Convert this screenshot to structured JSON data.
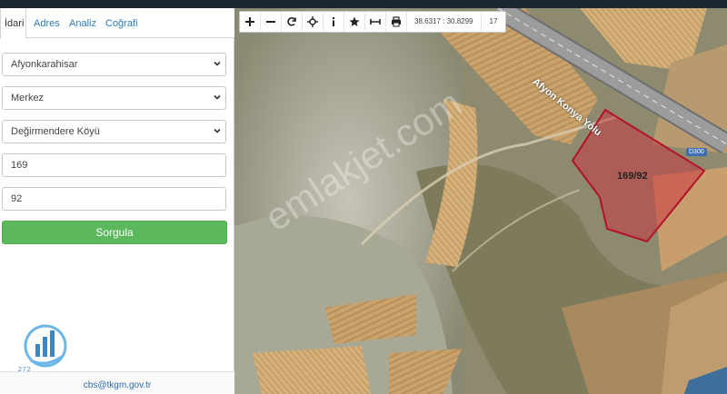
{
  "tabs": {
    "idari": "İdari",
    "adres": "Adres",
    "analiz": "Analiz",
    "cografi": "Coğrafi"
  },
  "form": {
    "il": "Afyonkarahisar",
    "ilce": "Merkez",
    "mahalle": "Değirmendere Köyü",
    "ada": "169",
    "parsel": "92",
    "query_label": "Sorgula"
  },
  "footer": {
    "email": "cbs@tkgm.gov.tr"
  },
  "logo": {
    "text": "272"
  },
  "map": {
    "coords": "38.6317 : 30.8299",
    "zoom": "17",
    "road_name": "Afyon Konya Yolu",
    "road_code": "D300",
    "parcel_label": "169/92",
    "watermark": "emlakjet.com"
  },
  "colors": {
    "query_button": "#5cb85c",
    "parcel_stroke": "#b3122a",
    "parcel_fill": "#c9383f",
    "tab_link": "#2a7ab8"
  },
  "icons": {
    "zoom_in": "plus-icon",
    "zoom_out": "minus-icon",
    "refresh": "refresh-icon",
    "locate": "crosshair-icon",
    "info": "info-icon",
    "bookmark": "star-icon",
    "measure": "measure-icon",
    "print": "print-icon"
  }
}
